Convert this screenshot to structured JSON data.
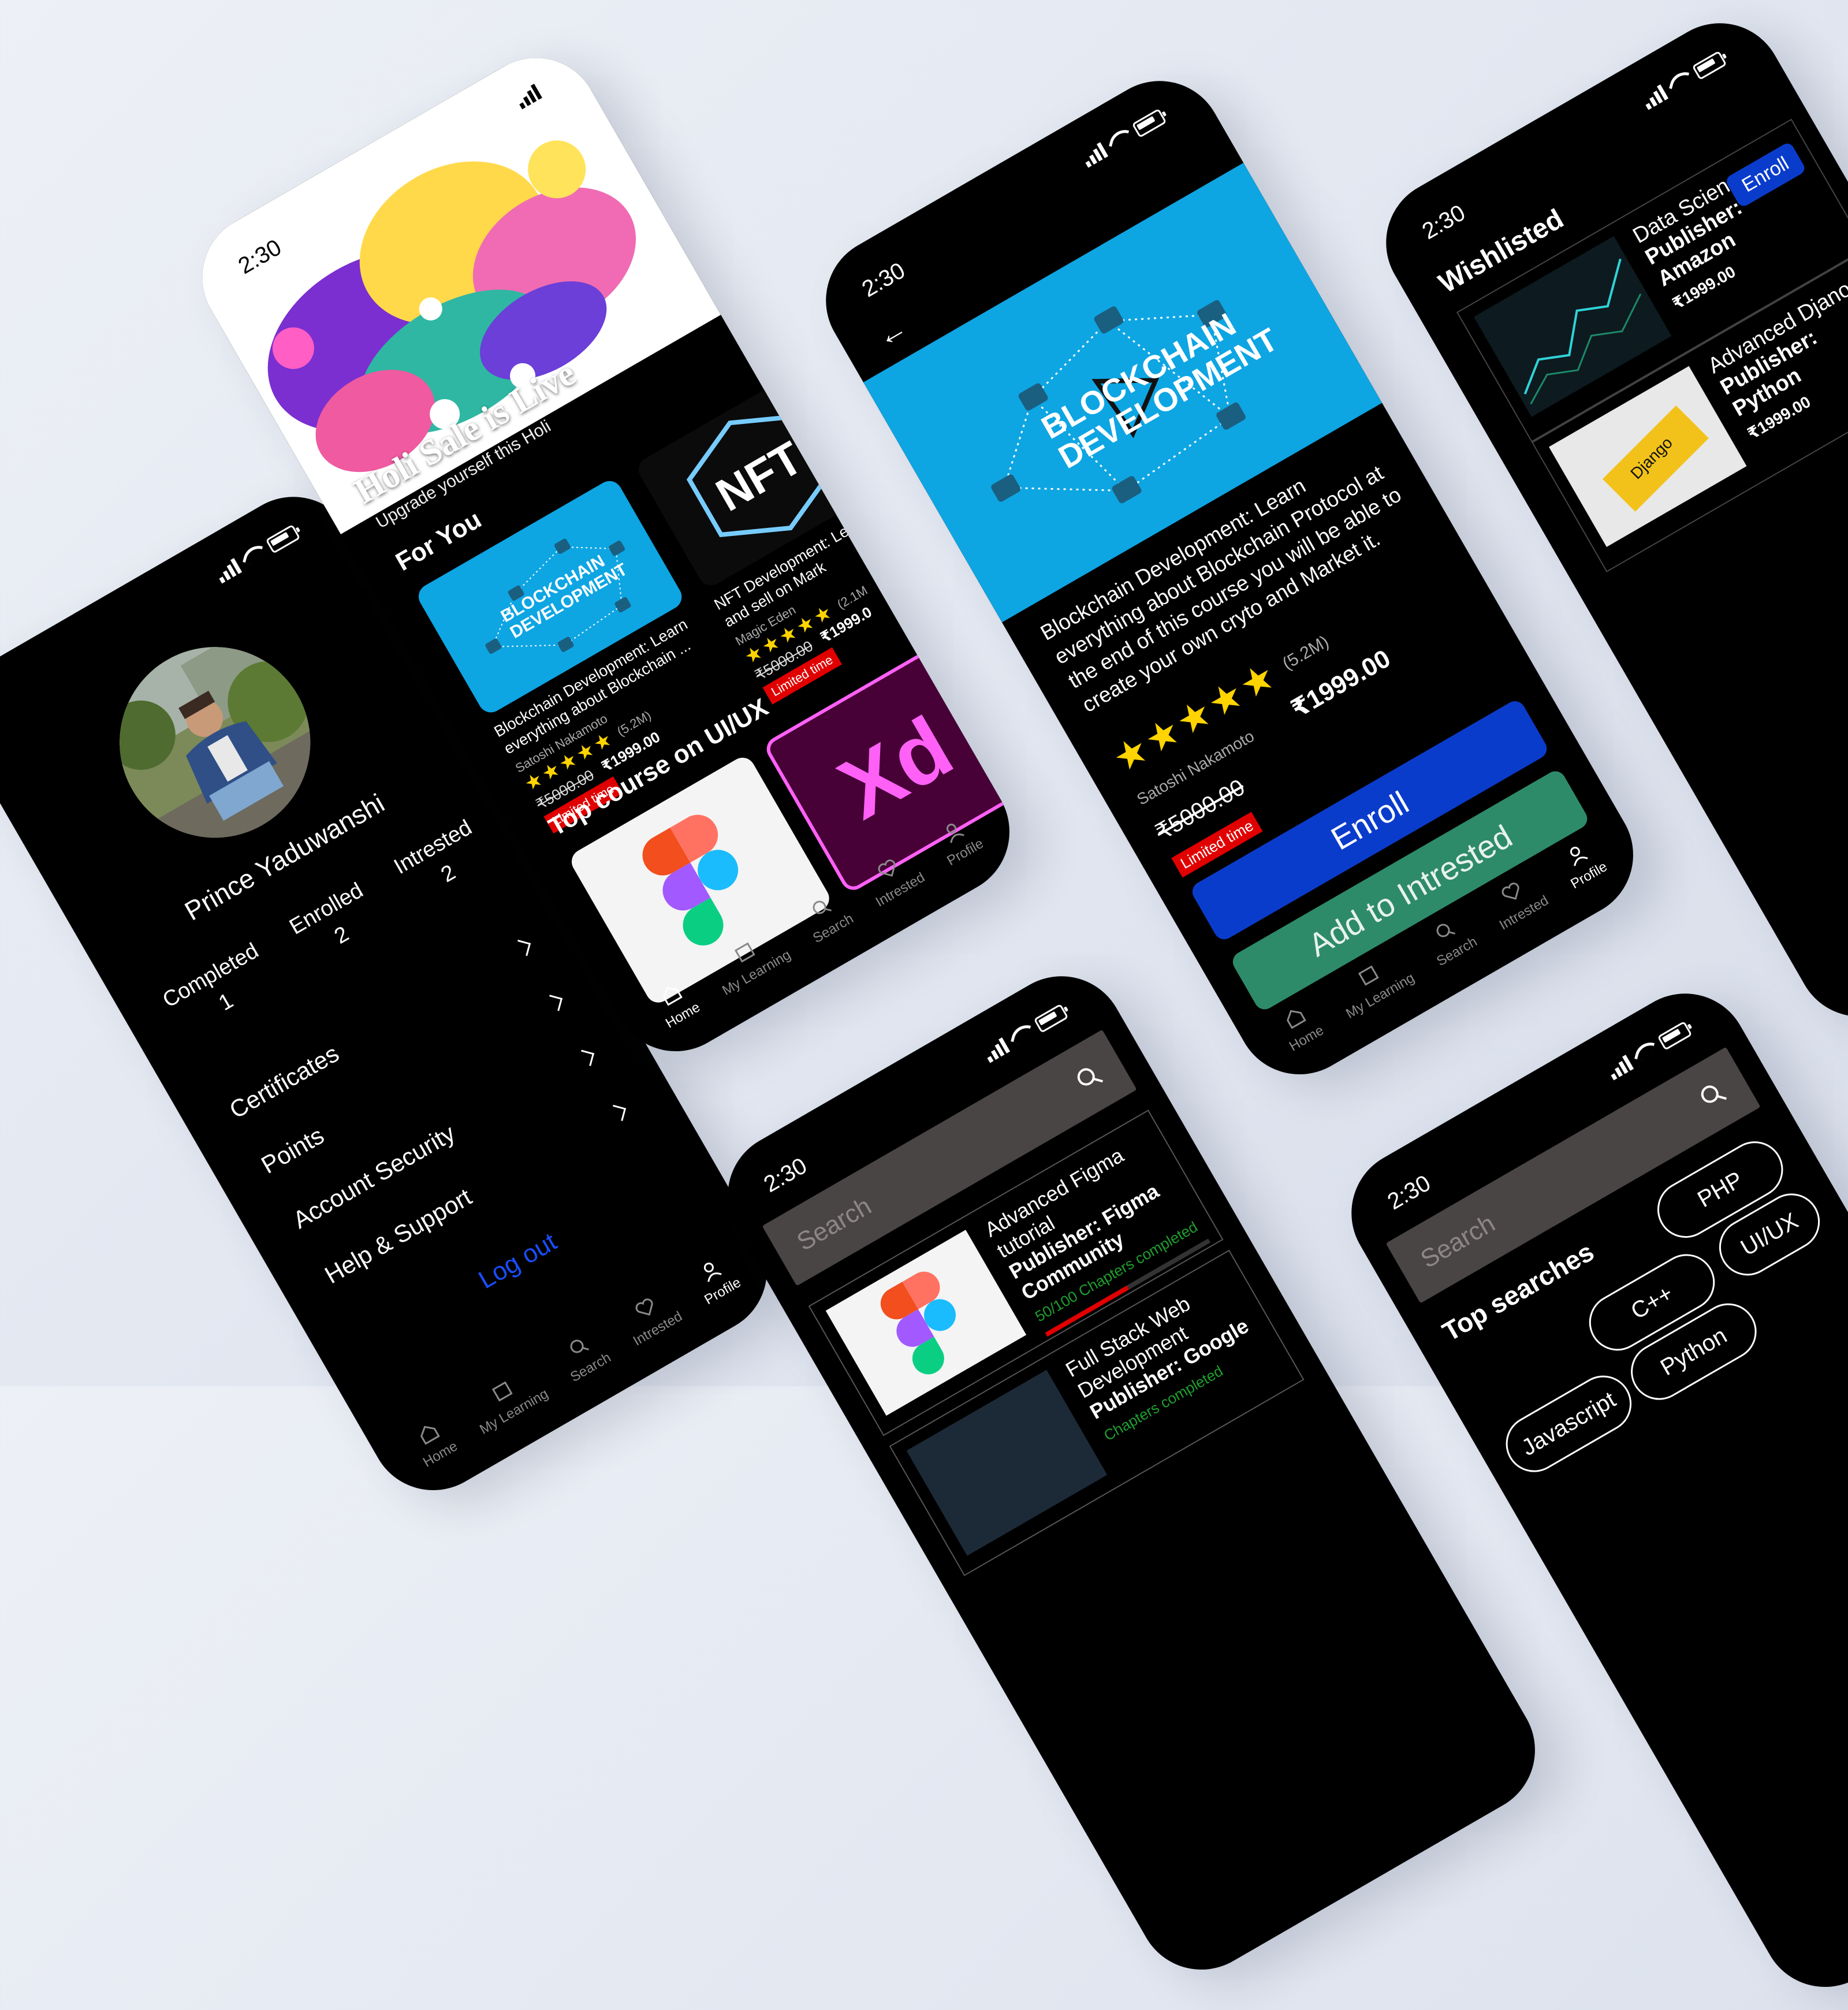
{
  "status": {
    "time": "2:30"
  },
  "nav": {
    "home": "Home",
    "my_learning": "My Learning",
    "search": "Search",
    "interested": "Intrested",
    "profile": "Profile"
  },
  "profile": {
    "name": "Prince Yaduwanshi",
    "stats": [
      {
        "label": "Completed",
        "value": "1"
      },
      {
        "label": "Enrolled",
        "value": "2"
      },
      {
        "label": "Intrested",
        "value": "2"
      }
    ],
    "menu": [
      "Certificates",
      "Points",
      "Account Security",
      "Help & Support"
    ],
    "logout": "Log out"
  },
  "home": {
    "banner_title": "Holi Sale is Live",
    "banner_subtitle": "Upgrade yourself this Holi",
    "section_for_you": "For You",
    "thumb_text": [
      "BLOCKCHAIN",
      "DEVELOPMENT"
    ],
    "nft_text": "NFT",
    "cards": [
      {
        "title": "Blockchain Development: Learn everything about Blockchain ...",
        "author": "Satoshi Nakamoto",
        "stars": "★★★★★",
        "rating_count": "(5.2M)",
        "old_price": "₹5000.00",
        "price": "₹1999.00",
        "badge": "Limited time"
      },
      {
        "title": "NFT Development: Le NFTs and sell on Mark",
        "author": "Magic Eden",
        "stars": "★★★★★",
        "rating_count": "(2.1M",
        "old_price": "₹5000.00",
        "price": "₹1999.0",
        "badge": "Limited time"
      }
    ],
    "section_top": "Top course on UI/UX",
    "xd_text": "Xd"
  },
  "detail": {
    "thumb_text": [
      "BLOCKCHAIN",
      "DEVELOPMENT"
    ],
    "title": "Blockchain Development: Learn everything about Blockchain Protocol at the end of this course you will be able to create your own cryto and Market it.",
    "stars": "★★★★★",
    "rating_count": "(5.2M)",
    "author": "Satoshi Nakamoto",
    "price": "₹1999.00",
    "old_price": "₹5000.00",
    "badge": "Limited time",
    "enroll": "Enroll",
    "add_interested": "Add to Intrested",
    "colors": {
      "enroll": "#0a3ccc",
      "interested": "#2e8b6a",
      "thumb": "#0ea5e3"
    }
  },
  "wishlist": {
    "title": "Wishlisted",
    "items": [
      {
        "name": "Data Science",
        "publisher": "Publisher: Amazon",
        "price": "₹1999.00",
        "action": "Enroll"
      },
      {
        "name": "Advanced Djano",
        "publisher": "Publisher: Python",
        "price": "₹1999.00"
      }
    ],
    "django_text": "Django"
  },
  "learning": {
    "search_placeholder": "Search",
    "items": [
      {
        "title": "Advanced Figma tutorial",
        "publisher": "Publisher: Figma Community",
        "progress_text": "50/100 Chapters completed",
        "progress": 0.5
      },
      {
        "title": "Full Stack Web Development",
        "publisher": "Publisher: Google",
        "progress_text": "Chapters completed"
      }
    ]
  },
  "search": {
    "placeholder": "Search",
    "top_searches": "Top searches",
    "chips": [
      "PHP",
      "C++",
      "UI/UX",
      "Python",
      "Javascript"
    ]
  }
}
